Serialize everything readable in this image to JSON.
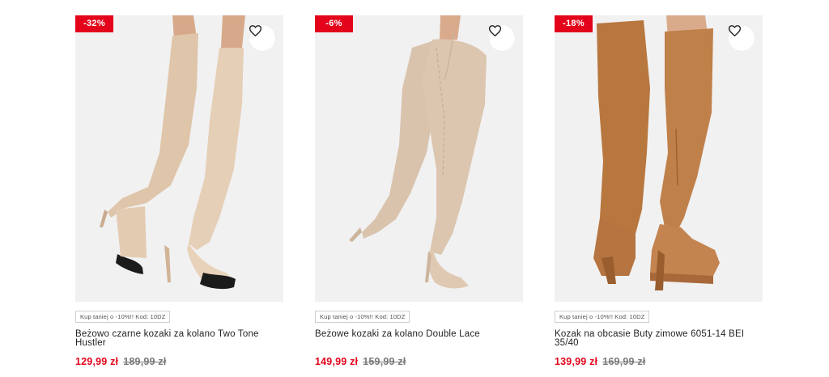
{
  "products": [
    {
      "discount": "-32%",
      "wishlist_icon": "heart-outline-icon",
      "promo": "Kup taniej o -10%!! Kod: 10DZ",
      "title": "Beżowo czarne kozaki za kolano Two Tone Hustler",
      "price": "129,99 zł",
      "old_price": "189,99 zł"
    },
    {
      "discount": "-6%",
      "wishlist_icon": "heart-outline-icon",
      "promo": "Kup taniej o -10%!! Kod: 10DZ",
      "title": "Beżowe kozaki za kolano Double Lace",
      "price": "149,99 zł",
      "old_price": "159,99 zł"
    },
    {
      "discount": "-18%",
      "wishlist_icon": "heart-outline-icon",
      "promo": "Kup taniej o -10%!! Kod: 10DZ",
      "title": "Kozak na obcasie Buty zimowe 6051-14 BEI 35/40",
      "price": "139,99 zł",
      "old_price": "169,99 zł"
    }
  ],
  "colors": {
    "sale_red": "#e3041b",
    "photo_bg": "#f1f1f1",
    "old_price": "#7a7a7a"
  }
}
